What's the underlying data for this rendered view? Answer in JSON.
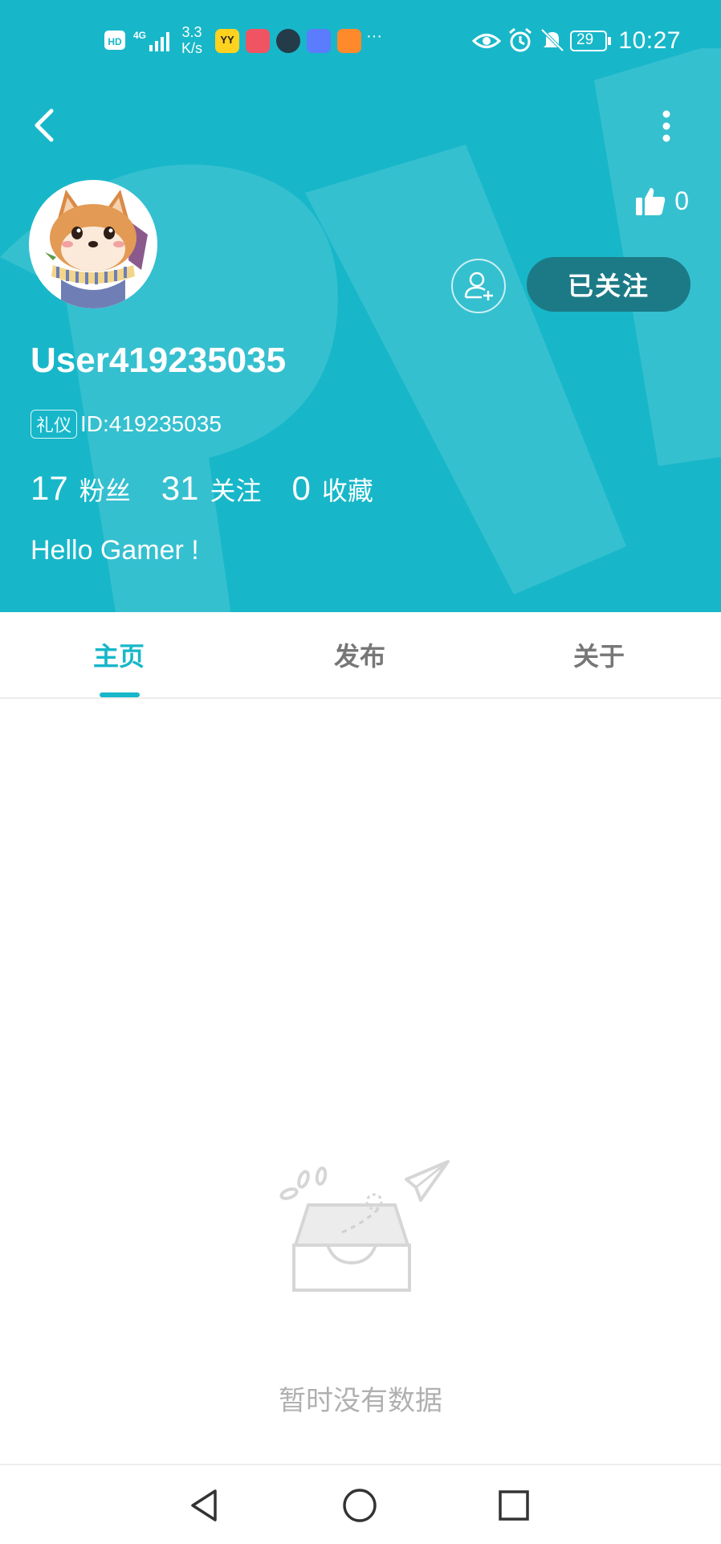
{
  "status_bar": {
    "network": "HD",
    "signal": "4G",
    "speed_value": "3.3",
    "speed_unit": "K/s",
    "battery": "29",
    "time": "10:27",
    "icons": [
      "hd-icon",
      "signal-icon",
      "yy-app-icon",
      "book-app-icon",
      "browser-app-icon",
      "music-app-icon",
      "video-app-icon",
      "eye-icon",
      "alarm-icon",
      "mute-icon",
      "battery-icon"
    ]
  },
  "header": {
    "like_count": "0",
    "follow_button_label": "已关注"
  },
  "profile": {
    "username": "User419235035",
    "tag": "礼仪",
    "id_text": "ID:419235035",
    "stats": [
      {
        "value": "17",
        "label": "粉丝"
      },
      {
        "value": "31",
        "label": "关注"
      },
      {
        "value": "0",
        "label": "收藏"
      }
    ],
    "bio": "Hello Gamer !"
  },
  "tabs": [
    {
      "label": "主页",
      "active": true
    },
    {
      "label": "发布",
      "active": false
    },
    {
      "label": "关于",
      "active": false
    }
  ],
  "empty_state": {
    "message": "暂时没有数据"
  },
  "colors": {
    "accent": "#17b7c9",
    "follow_button": "#1c7a86"
  }
}
